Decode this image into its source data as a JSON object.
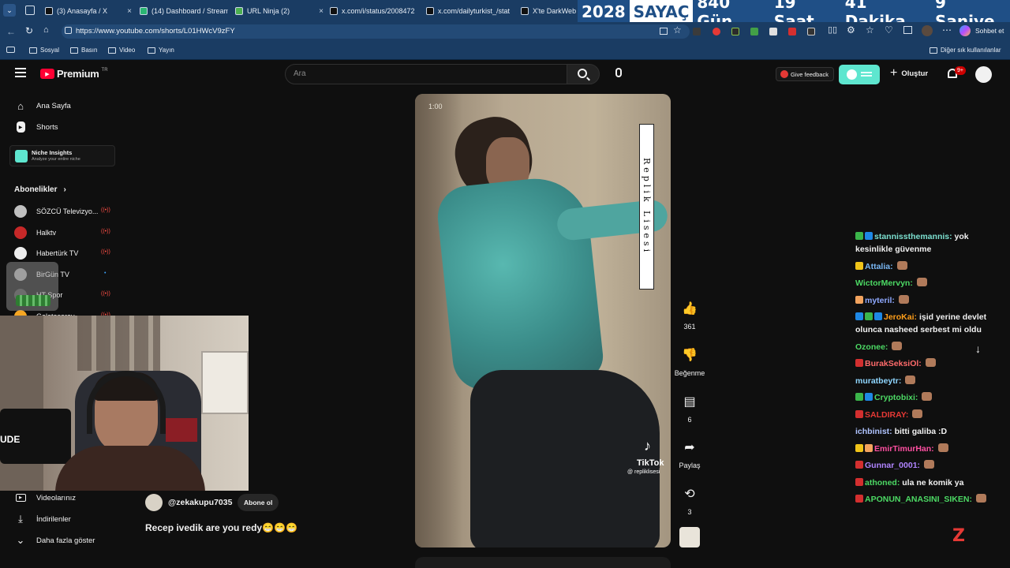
{
  "browser": {
    "tabs": [
      {
        "label": "(3) Anasayfa / X",
        "fav": "#111"
      },
      {
        "label": "(14) Dashboard / Stream",
        "fav": "#2bb673"
      },
      {
        "label": "URL Ninja (2)",
        "fav": "#4caf50"
      },
      {
        "label": "x.com/i/status/2008472",
        "fav": "#111"
      },
      {
        "label": "x.com/dailyturkist_/stat",
        "fav": "#111"
      },
      {
        "label": "X'te DarkWeb H",
        "fav": "#111"
      }
    ],
    "url": "https://www.youtube.com/shorts/L01HWcV9zFY",
    "bookmarks": [
      "Sosyal",
      "Basın",
      "Video",
      "Yayın"
    ],
    "bookmarks_right": "Diğer sık kullanılanlar",
    "copilot_label": "Sohbet et"
  },
  "counter": {
    "year": "2028",
    "sayac": "SAYAÇ",
    "days": "840 Gün",
    "hours": "19 Saat",
    "minutes": "41 Dakika",
    "seconds": "9 Saniye"
  },
  "youtube": {
    "logo": "Premium",
    "logo_region": "TR",
    "search_placeholder": "Ara",
    "give_feedback": "Give feedback",
    "create": "Oluştur",
    "notif_count": "9+",
    "sidebar": {
      "home": "Ana Sayfa",
      "shorts": "Shorts",
      "niche_title": "Niche Insights",
      "niche_sub": "Analyze your entire niche",
      "subs_header": "Abonelikler",
      "channels": [
        {
          "name": "SÖZCÜ Televizyo...",
          "color": "#c0c0c0",
          "live": true
        },
        {
          "name": "Halktv",
          "color": "#c62828",
          "live": true
        },
        {
          "name": "Habertürk TV",
          "color": "#eeeeee",
          "live": true
        },
        {
          "name": "BirGün TV",
          "color": "#9e9e9e",
          "live": false
        },
        {
          "name": "HT Spor",
          "color": "#444",
          "live": true
        },
        {
          "name": "Galatasaray",
          "color": "#f5a623",
          "live": true
        }
      ],
      "your_videos": "Videolarınız",
      "downloads": "İndirilenler",
      "show_more": "Daha fazla göster"
    },
    "short": {
      "time": "1:00",
      "vertical_text": "Replik Lisesi",
      "tiktok": "TikTok",
      "tiktok_handle": "@ repliklisesi",
      "channel": "@zekakupu7035",
      "subscribe": "Abone ol",
      "title": "Recep ivedik are you redy😁😁😁",
      "likes": "361",
      "dislike": "Beğenme",
      "comments": "6",
      "share": "Paylaş",
      "remix": "3"
    }
  },
  "webcam": {
    "overlay_text": "UDE"
  },
  "chat": [
    {
      "user": "stannissthemannis:",
      "color": "#7ce0d0",
      "msg": "yok kesinlikle güvenme",
      "badges": [
        "#3bb54a",
        "#1e88e5"
      ]
    },
    {
      "user": "Attalia:",
      "color": "#7ab8f5",
      "msg": "",
      "badges": [
        "#f0c419"
      ]
    },
    {
      "user": "WictorMervyn:",
      "color": "#4cd964",
      "msg": "",
      "badges": []
    },
    {
      "user": "myteril:",
      "color": "#8fa9ff",
      "msg": "",
      "badges": [
        "#f2a35e"
      ]
    },
    {
      "user": "JeroKai:",
      "color": "#ff9f1a",
      "msg": "işid yerine devlet olunca nasheed serbest mi oldu",
      "badges": [
        "#1e88e5",
        "#3bb54a",
        "#1e88e5"
      ]
    },
    {
      "user": "Ozonee:",
      "color": "#4cd964",
      "msg": "",
      "badges": []
    },
    {
      "user": "BurakSeksiOl:",
      "color": "#ff6b6b",
      "msg": "",
      "badges": [
        "#d32f2f"
      ]
    },
    {
      "user": "muratbeytr:",
      "color": "#8fd6ff",
      "msg": "",
      "badges": []
    },
    {
      "user": "Cryptobixi:",
      "color": "#4cd964",
      "msg": "",
      "badges": [
        "#3bb54a",
        "#1e88e5"
      ]
    },
    {
      "user": "SALDIRAY:",
      "color": "#e53935",
      "msg": "",
      "badges": [
        "#d32f2f"
      ]
    },
    {
      "user": "ichbinist:",
      "color": "#b0c4ff",
      "msg": "bitti galiba :D",
      "badges": []
    },
    {
      "user": "EmirTimurHan:",
      "color": "#ff4fa1",
      "msg": "",
      "badges": [
        "#f0c419",
        "#f2a35e"
      ]
    },
    {
      "user": "Gunnar_0001:",
      "color": "#b084ff",
      "msg": "",
      "badges": [
        "#d32f2f"
      ]
    },
    {
      "user": "athoned:",
      "color": "#4cd964",
      "msg": "ula ne komik ya",
      "badges": [
        "#d32f2f"
      ]
    },
    {
      "user": "APONUN_ANASINI_SIKEN:",
      "color": "#4cd964",
      "msg": "",
      "badges": [
        "#d32f2f"
      ]
    }
  ],
  "colors": {
    "browser_chrome": "#1a3c63",
    "yt_bg": "#0f0f0f",
    "yt_red": "#ff0033",
    "feedback_toggle": "#5ee6cf"
  }
}
